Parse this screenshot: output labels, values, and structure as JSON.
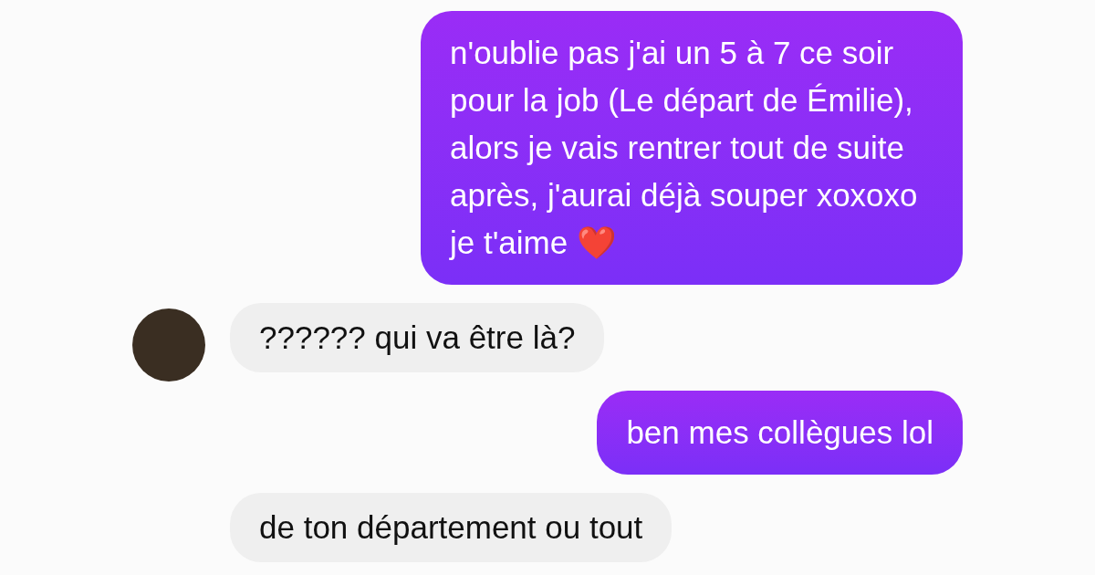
{
  "messages": [
    {
      "kind": "sent",
      "text": "n'oublie pas j'ai un 5 à 7 ce soir pour la job (Le départ de Émilie), alors je vais rentrer tout de suite après, j'aurai déjà souper xoxoxo je t'aime ❤️"
    },
    {
      "kind": "received",
      "text": "?????? qui va être là?",
      "avatar": true
    },
    {
      "kind": "sent",
      "text": "ben mes collègues lol"
    },
    {
      "kind": "received",
      "text": "de ton département ou tout",
      "avatar": false
    }
  ]
}
